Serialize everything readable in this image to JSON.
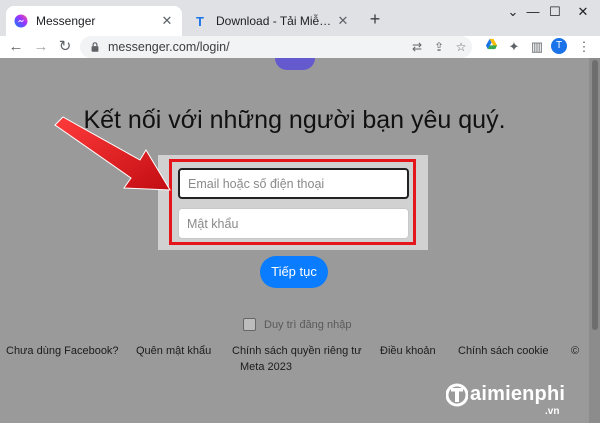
{
  "browser": {
    "tabs": [
      {
        "title": "Messenger",
        "active": true,
        "icon": "messenger-icon"
      },
      {
        "title": "Download - Tải Miễn Phí VN - Phần",
        "active": false,
        "icon": "taimienphi-icon"
      }
    ],
    "url": "messenger.com/login/",
    "profile_initial": "T"
  },
  "page": {
    "headline": "Kết nối với những người bạn yêu quý.",
    "email_placeholder": "Email hoặc số điện thoại",
    "password_placeholder": "Mật khẩu",
    "continue_label": "Tiếp tục",
    "keep_signed_in_label": "Duy trì đăng nhập",
    "footer_links": [
      "Chưa dùng Facebook?",
      "Quên mật khẩu",
      "Chính sách quyền riêng tư",
      "Điều khoản",
      "Chính sách cookie",
      "©"
    ],
    "meta_text": "Meta 2023"
  },
  "annotation": {
    "arrow_color": "#e4161b",
    "box_color": "#e4161b"
  },
  "watermark": {
    "brand": "aimienphi",
    "tld": ".vn"
  }
}
